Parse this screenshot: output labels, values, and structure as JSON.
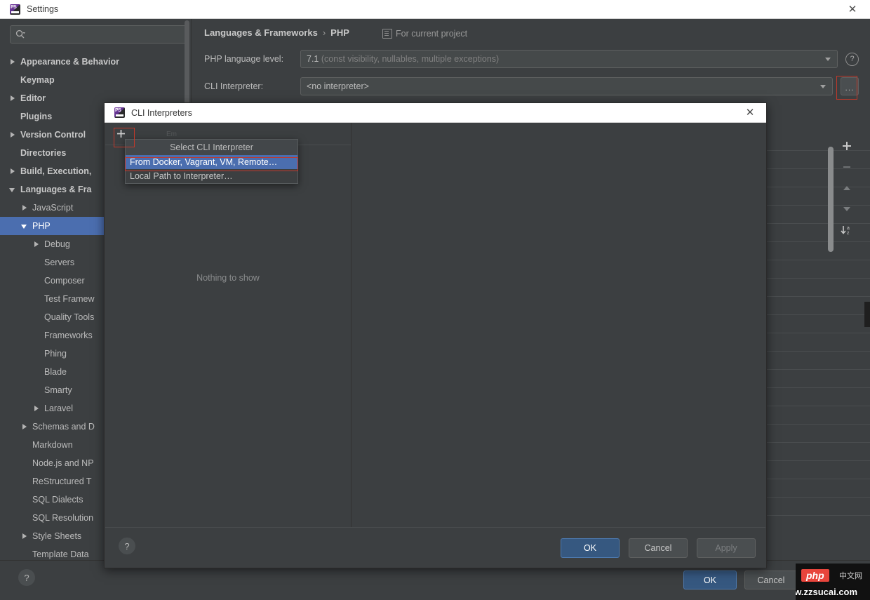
{
  "settings_window": {
    "title": "Settings",
    "icon": "phpstorm-icon",
    "close_icon": "close-icon",
    "search": {
      "placeholder": "",
      "value": "",
      "icon": "search-icon"
    },
    "sidebar": {
      "items": [
        {
          "label": "Appearance & Behavior",
          "indent": 0,
          "twisty": "closed",
          "bold": true
        },
        {
          "label": "Keymap",
          "indent": 0,
          "twisty": "none",
          "bold": true
        },
        {
          "label": "Editor",
          "indent": 0,
          "twisty": "closed",
          "bold": true
        },
        {
          "label": "Plugins",
          "indent": 0,
          "twisty": "none",
          "bold": true
        },
        {
          "label": "Version Control",
          "indent": 0,
          "twisty": "closed",
          "bold": true
        },
        {
          "label": "Directories",
          "indent": 0,
          "twisty": "none",
          "bold": true
        },
        {
          "label": "Build, Execution,",
          "indent": 0,
          "twisty": "closed",
          "bold": true
        },
        {
          "label": "Languages & Fra",
          "indent": 0,
          "twisty": "open",
          "bold": true
        },
        {
          "label": "JavaScript",
          "indent": 1,
          "twisty": "closed",
          "bold": false
        },
        {
          "label": "PHP",
          "indent": 1,
          "twisty": "open",
          "bold": false,
          "selected": true
        },
        {
          "label": "Debug",
          "indent": 2,
          "twisty": "closed",
          "bold": false
        },
        {
          "label": "Servers",
          "indent": 2,
          "twisty": "none",
          "bold": false
        },
        {
          "label": "Composer",
          "indent": 2,
          "twisty": "none",
          "bold": false
        },
        {
          "label": "Test Framew",
          "indent": 2,
          "twisty": "none",
          "bold": false
        },
        {
          "label": "Quality Tools",
          "indent": 2,
          "twisty": "none",
          "bold": false
        },
        {
          "label": "Frameworks",
          "indent": 2,
          "twisty": "none",
          "bold": false
        },
        {
          "label": "Phing",
          "indent": 2,
          "twisty": "none",
          "bold": false
        },
        {
          "label": "Blade",
          "indent": 2,
          "twisty": "none",
          "bold": false
        },
        {
          "label": "Smarty",
          "indent": 2,
          "twisty": "none",
          "bold": false
        },
        {
          "label": "Laravel",
          "indent": 2,
          "twisty": "closed",
          "bold": false
        },
        {
          "label": "Schemas and D",
          "indent": 1,
          "twisty": "closed",
          "bold": false
        },
        {
          "label": "Markdown",
          "indent": 1,
          "twisty": "none",
          "bold": false
        },
        {
          "label": "Node.js and NP",
          "indent": 1,
          "twisty": "none",
          "bold": false
        },
        {
          "label": "ReStructured T",
          "indent": 1,
          "twisty": "none",
          "bold": false
        },
        {
          "label": "SQL Dialects",
          "indent": 1,
          "twisty": "none",
          "bold": false
        },
        {
          "label": "SQL Resolution",
          "indent": 1,
          "twisty": "none",
          "bold": false
        },
        {
          "label": "Style Sheets",
          "indent": 1,
          "twisty": "closed",
          "bold": false
        },
        {
          "label": "Template Data",
          "indent": 1,
          "twisty": "none",
          "bold": false
        }
      ]
    },
    "content": {
      "breadcrumb": {
        "parent": "Languages & Frameworks",
        "separator": "›",
        "current": "PHP"
      },
      "for_current_project": {
        "label": "For current project",
        "icon": "project-scope-icon"
      },
      "php_language_level": {
        "label": "PHP language level:",
        "value": "7.1",
        "value_detail": "(const visibility, nullables, multiple exceptions)",
        "help_icon": "question-icon"
      },
      "cli_interpreter": {
        "label": "CLI Interpreter:",
        "value": "<no interpreter>",
        "browse_button": "...",
        "browse_highlighted": true
      },
      "side_toolbar": [
        {
          "icon": "plus-icon",
          "glyph": "+"
        },
        {
          "icon": "minus-icon",
          "glyph": "–"
        },
        {
          "icon": "arrow-up-icon",
          "glyph": "▲"
        },
        {
          "icon": "arrow-down-icon",
          "glyph": "▼"
        },
        {
          "icon": "sort-az-icon",
          "glyph": "↓"
        }
      ]
    },
    "footer": {
      "help_icon": "question-icon",
      "ok": "OK",
      "cancel": "Cancel"
    }
  },
  "cli_dialog": {
    "title": "CLI Interpreters",
    "icon": "phpstorm-icon",
    "close_icon": "close-icon",
    "toolbar": {
      "add": "+",
      "add_icon": "plus-icon",
      "add_highlighted": true
    },
    "empty_state": "Nothing to show",
    "ghost_label": "Em",
    "footer": {
      "help_icon": "question-icon",
      "ok": "OK",
      "cancel": "Cancel",
      "apply": "Apply",
      "apply_disabled": true
    }
  },
  "popup_menu": {
    "header": "Select CLI Interpreter",
    "items": [
      {
        "label": "From Docker, Vagrant, VM, Remote…",
        "highlighted": true
      },
      {
        "label": "Local Path to Interpreter…",
        "highlighted": false
      }
    ]
  },
  "watermark": {
    "badge": "php",
    "cn_text": "中文网",
    "url": "www.zzsucai.com"
  },
  "colors": {
    "window_bg": "#3c3f41",
    "titlebar_bg": "#ffffff",
    "accent_blue": "#4b6eaf",
    "primary_button": "#365880",
    "annotation_red": "#c0392b",
    "text": "#bbbbbb",
    "dim_text": "#808080"
  }
}
